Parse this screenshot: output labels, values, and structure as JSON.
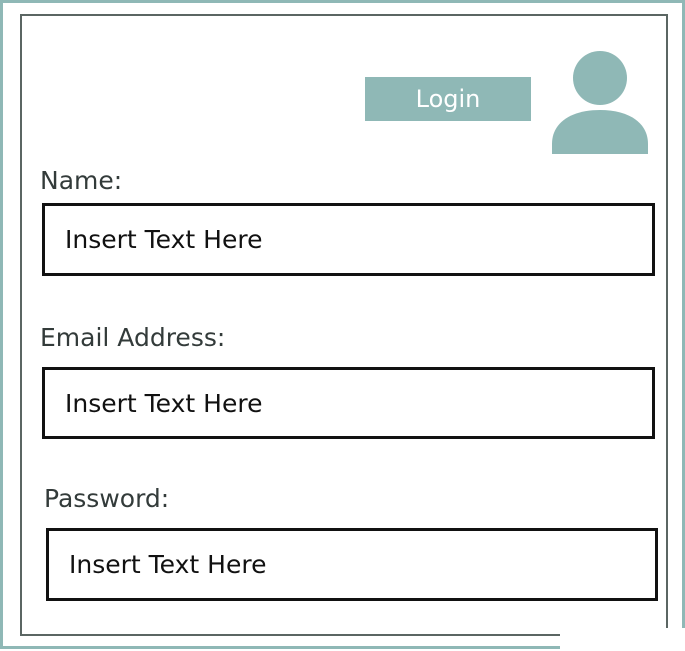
{
  "header": {
    "login_label": "Login",
    "avatar_icon": "user-avatar-icon"
  },
  "form": {
    "name": {
      "label": "Name:",
      "placeholder": "Insert Text Here"
    },
    "email": {
      "label": "Email Address:",
      "placeholder": "Insert Text Here"
    },
    "password": {
      "label": "Password:",
      "placeholder": "Insert Text Here"
    }
  },
  "colors": {
    "accent": "#8fb8b6",
    "border": "#111111",
    "frame_inner": "#5b6663"
  }
}
